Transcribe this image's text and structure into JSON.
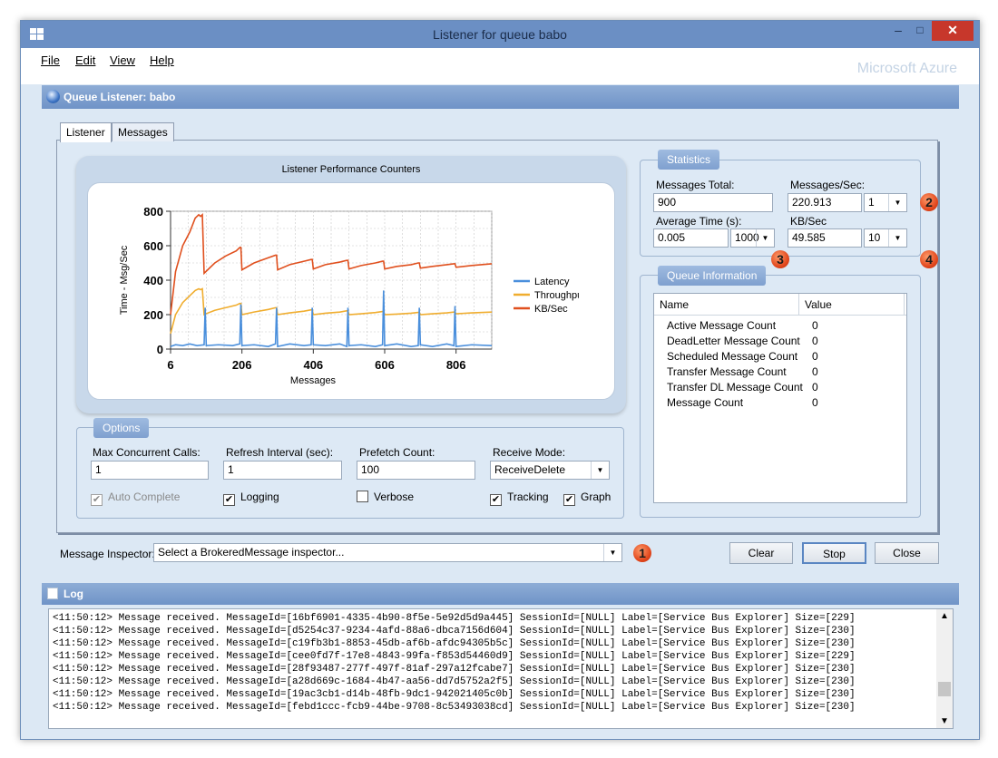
{
  "window": {
    "title": "Listener for queue babo",
    "minimize": "–",
    "maximize": "□",
    "close": "✕"
  },
  "menu": {
    "file": "File",
    "edit": "Edit",
    "view": "View",
    "help": "Help",
    "brand": "Microsoft Azure"
  },
  "panel": {
    "title": "Queue Listener: babo"
  },
  "tabs": [
    {
      "label": "Listener",
      "active": true
    },
    {
      "label": "Messages",
      "active": false
    }
  ],
  "chart": {
    "title": "Listener Performance Counters",
    "xlabel": "Messages",
    "ylabel": "Time - Msg/Sec",
    "legend": [
      "Latency",
      "Throughput",
      "KB/Sec"
    ]
  },
  "chart_data": {
    "type": "line",
    "title": "Listener Performance Counters",
    "xlabel": "Messages",
    "ylabel": "Time - Msg/Sec",
    "xlim": [
      6,
      906
    ],
    "ylim": [
      0,
      800
    ],
    "xticks": [
      6,
      206,
      406,
      606,
      806
    ],
    "yticks": [
      0,
      200,
      400,
      600,
      800
    ],
    "grid": true,
    "legend_position": "right",
    "series": [
      {
        "name": "KB/Sec",
        "color": "#e0501e",
        "x": [
          6,
          20,
          40,
          60,
          75,
          85,
          90,
          95,
          100,
          105,
          130,
          160,
          190,
          200,
          203,
          206,
          240,
          280,
          300,
          303,
          306,
          340,
          380,
          400,
          403,
          406,
          440,
          480,
          500,
          503,
          506,
          540,
          580,
          600,
          603,
          606,
          640,
          680,
          700,
          703,
          706,
          740,
          780,
          800,
          803,
          806,
          850,
          906
        ],
        "y": [
          200,
          450,
          600,
          680,
          760,
          780,
          770,
          780,
          440,
          450,
          500,
          540,
          570,
          590,
          590,
          460,
          500,
          530,
          545,
          545,
          460,
          490,
          510,
          520,
          520,
          465,
          490,
          505,
          515,
          515,
          465,
          485,
          500,
          510,
          510,
          465,
          480,
          490,
          500,
          500,
          470,
          480,
          490,
          495,
          495,
          475,
          485,
          495
        ]
      },
      {
        "name": "Throughput",
        "color": "#f0ad2e",
        "x": [
          6,
          20,
          40,
          60,
          75,
          85,
          90,
          95,
          100,
          105,
          130,
          160,
          190,
          200,
          203,
          206,
          240,
          280,
          300,
          303,
          306,
          340,
          380,
          400,
          403,
          406,
          440,
          480,
          500,
          503,
          506,
          540,
          580,
          600,
          603,
          606,
          640,
          680,
          700,
          703,
          706,
          740,
          780,
          800,
          803,
          806,
          850,
          906
        ],
        "y": [
          90,
          200,
          270,
          310,
          340,
          350,
          345,
          350,
          200,
          205,
          225,
          240,
          255,
          265,
          265,
          200,
          215,
          230,
          240,
          240,
          200,
          210,
          220,
          228,
          228,
          200,
          208,
          215,
          222,
          222,
          200,
          205,
          212,
          218,
          218,
          200,
          203,
          208,
          213,
          213,
          200,
          205,
          210,
          215,
          215,
          205,
          210,
          215
        ]
      },
      {
        "name": "Latency",
        "color": "#4a8fdc",
        "x": [
          6,
          20,
          40,
          60,
          80,
          100,
          103,
          106,
          140,
          180,
          200,
          203,
          206,
          240,
          280,
          300,
          303,
          306,
          340,
          380,
          400,
          403,
          406,
          440,
          480,
          500,
          503,
          506,
          540,
          580,
          600,
          603,
          606,
          640,
          680,
          700,
          703,
          706,
          740,
          780,
          800,
          803,
          806,
          850,
          906
        ],
        "y": [
          15,
          25,
          20,
          30,
          20,
          25,
          240,
          20,
          25,
          20,
          30,
          260,
          20,
          25,
          15,
          30,
          240,
          15,
          30,
          20,
          25,
          240,
          25,
          20,
          30,
          15,
          240,
          20,
          25,
          15,
          25,
          340,
          20,
          30,
          15,
          20,
          240,
          25,
          15,
          30,
          20,
          250,
          15,
          25,
          20
        ]
      }
    ]
  },
  "options": {
    "title": "Options",
    "max_concurrent_label": "Max Concurrent Calls:",
    "max_concurrent_value": "1",
    "refresh_label": "Refresh Interval (sec):",
    "refresh_value": "1",
    "prefetch_label": "Prefetch Count:",
    "prefetch_value": "100",
    "receive_mode_label": "Receive Mode:",
    "receive_mode_value": "ReceiveDelete",
    "auto_complete": "Auto Complete",
    "logging": "Logging",
    "verbose": "Verbose",
    "tracking": "Tracking",
    "graph": "Graph"
  },
  "statistics": {
    "title": "Statistics",
    "messages_total_label": "Messages Total:",
    "messages_total_value": "900",
    "messages_sec_label": "Messages/Sec:",
    "messages_sec_value": "220.913",
    "messages_sec_interval": "1",
    "avg_time_label": "Average Time (s):",
    "avg_time_value": "0.005",
    "avg_time_interval": "1000",
    "kb_sec_label": "KB/Sec",
    "kb_sec_value": "49.585",
    "kb_sec_interval": "10"
  },
  "queue_info": {
    "title": "Queue Information",
    "col_name": "Name",
    "col_value": "Value",
    "rows": [
      {
        "name": "Active Message Count",
        "value": "0"
      },
      {
        "name": "DeadLetter Message Count",
        "value": "0"
      },
      {
        "name": "Scheduled Message Count",
        "value": "0"
      },
      {
        "name": "Transfer Message Count",
        "value": "0"
      },
      {
        "name": "Transfer DL Message Count",
        "value": "0"
      },
      {
        "name": "Message Count",
        "value": "0"
      }
    ]
  },
  "badges": {
    "b1": "1",
    "b2": "2",
    "b3": "3",
    "b4": "4"
  },
  "inspector": {
    "label": "Message Inspector:",
    "value": "Select a BrokeredMessage inspector..."
  },
  "buttons": {
    "clear": "Clear",
    "stop": "Stop",
    "close": "Close"
  },
  "log": {
    "title": "Log",
    "lines": [
      "<11:50:12> Message received. MessageId=[16bf6901-4335-4b90-8f5e-5e92d5d9a445] SessionId=[NULL] Label=[Service Bus Explorer] Size=[229]",
      "<11:50:12> Message received. MessageId=[d5254c37-9234-4afd-88a6-dbca7156d604] SessionId=[NULL] Label=[Service Bus Explorer] Size=[230]",
      "<11:50:12> Message received. MessageId=[c19fb3b1-8853-45db-af6b-afdc94305b5c] SessionId=[NULL] Label=[Service Bus Explorer] Size=[230]",
      "<11:50:12> Message received. MessageId=[cee0fd7f-17e8-4843-99fa-f853d54460d9] SessionId=[NULL] Label=[Service Bus Explorer] Size=[229]",
      "<11:50:12> Message received. MessageId=[28f93487-277f-497f-81af-297a12fcabe7] SessionId=[NULL] Label=[Service Bus Explorer] Size=[230]",
      "<11:50:12> Message received. MessageId=[a28d669c-1684-4b47-aa56-dd7d5752a2f5] SessionId=[NULL] Label=[Service Bus Explorer] Size=[230]",
      "<11:50:12> Message received. MessageId=[19ac3cb1-d14b-48fb-9dc1-942021405c0b] SessionId=[NULL] Label=[Service Bus Explorer] Size=[230]",
      "<11:50:12> Message received. MessageId=[febd1ccc-fcb9-44be-9708-8c53493038cd] SessionId=[NULL] Label=[Service Bus Explorer] Size=[230]"
    ]
  }
}
